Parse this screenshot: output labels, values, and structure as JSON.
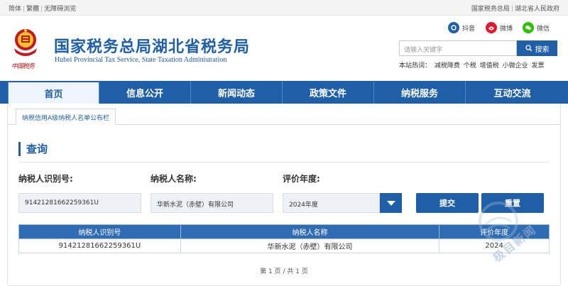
{
  "topbar": {
    "left_links": [
      "简体",
      "繁體",
      "无障碍浏览"
    ],
    "right_links": [
      "国家税务总局",
      "湖北省人民政府"
    ]
  },
  "header": {
    "title": "国家税务总局湖北省税务局",
    "subtitle": "Hubei Provincial Tax Service, State Taxation Administration",
    "emblem_text": "中国税务"
  },
  "social": {
    "douyin": "抖音",
    "weibo": "微博",
    "weixin": "微信"
  },
  "search": {
    "placeholder": "请输入关键字",
    "button": "搜索",
    "hot_label": "本站热词：",
    "hot_words": [
      "减税降费",
      "个税",
      "增值税",
      "小微企业",
      "发票"
    ]
  },
  "nav": {
    "items": [
      "首页",
      "信息公开",
      "新闻动态",
      "政策文件",
      "纳税服务",
      "互动交流"
    ],
    "active": "首页"
  },
  "tab": {
    "label": "纳税信用A级纳税人名单公布栏"
  },
  "query": {
    "section_title": "查询",
    "label_taxid": "纳税人识别号:",
    "label_name": "纳税人名称:",
    "label_year": "评价年度:",
    "value_taxid": "91421281662259361U",
    "value_name": "华新水泥（赤壁）有限公司",
    "value_year": "2024年度",
    "submit": "提交",
    "reset": "重置"
  },
  "results": {
    "columns": [
      "纳税人识别号",
      "纳税人名称",
      "评价年度"
    ],
    "rows": [
      [
        "91421281662259361U",
        "华新水泥（赤壁）有限公司",
        "2024"
      ]
    ],
    "pagination": "第 1 页 / 共 1 页"
  },
  "watermark": {
    "text": "极目新闻"
  },
  "colors": {
    "brand": "#1f5fa8",
    "red": "#c8161d"
  }
}
